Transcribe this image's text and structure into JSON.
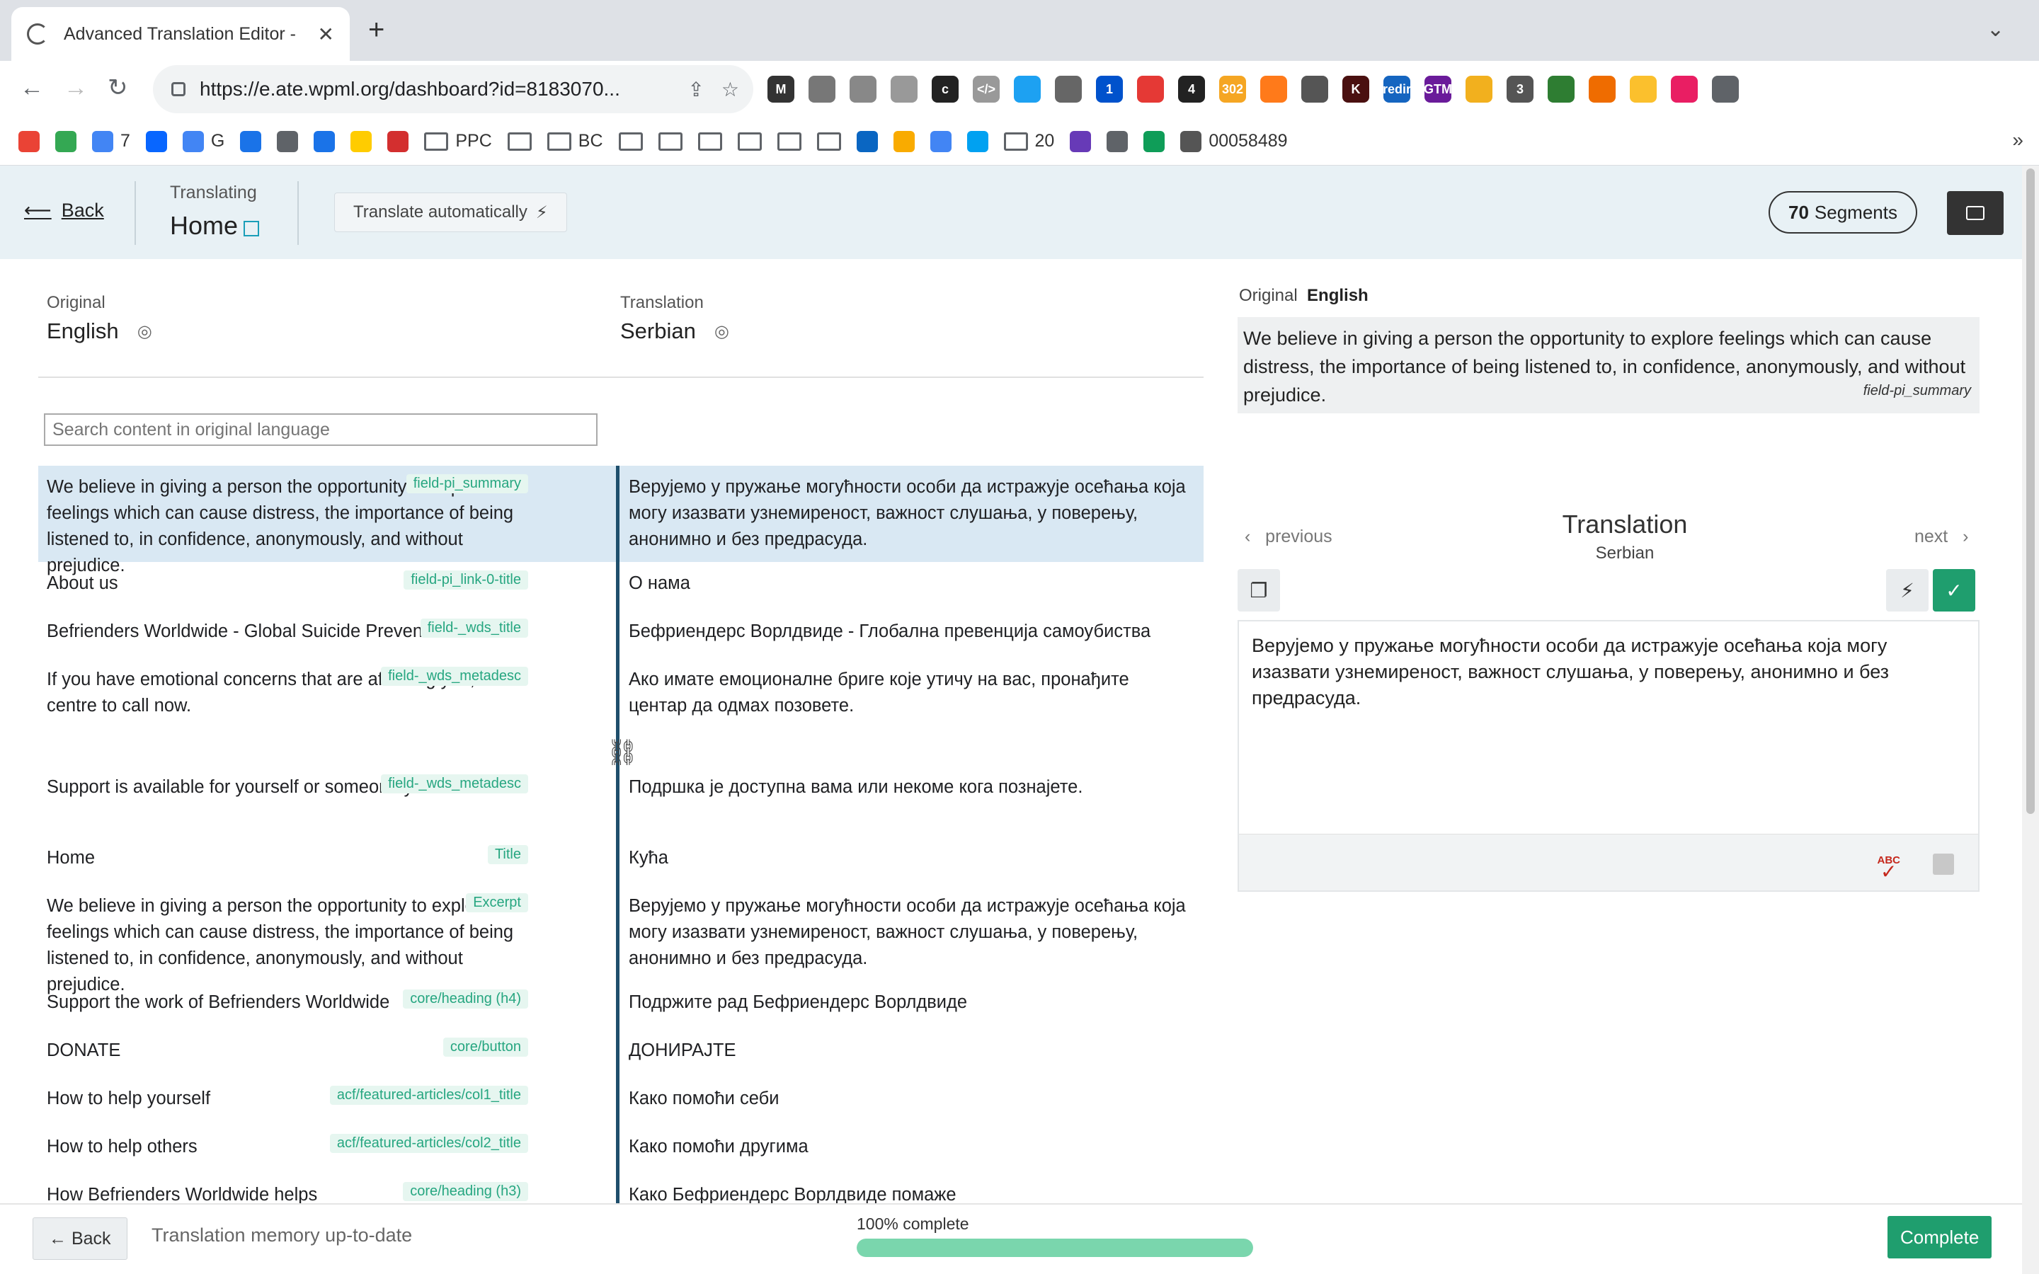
{
  "browser": {
    "tab_title": "Advanced Translation Editor -",
    "url": "https://e.ate.wpml.org/dashboard?id=8183070...",
    "extensions": [
      {
        "label": "M",
        "color": "#333333"
      },
      {
        "label": "",
        "color": "#777777"
      },
      {
        "label": "",
        "color": "#888888"
      },
      {
        "label": "",
        "color": "#999999"
      },
      {
        "label": "c",
        "color": "#222222"
      },
      {
        "label": "</>",
        "color": "#999999"
      },
      {
        "label": "",
        "color": "#1da1f2"
      },
      {
        "label": "",
        "color": "#666666"
      },
      {
        "label": "1",
        "color": "#0052cc"
      },
      {
        "label": "",
        "color": "#e53935"
      },
      {
        "label": "4",
        "color": "#222222"
      },
      {
        "label": "302",
        "color": "#f5a623"
      },
      {
        "label": "",
        "color": "#ff7a1a"
      },
      {
        "label": "",
        "color": "#555555"
      },
      {
        "label": "K",
        "color": "#4a1010"
      },
      {
        "label": "redir",
        "color": "#1565c0"
      },
      {
        "label": "GTM",
        "color": "#6a1b9a"
      },
      {
        "label": "",
        "color": "#f2b01e"
      },
      {
        "label": "3",
        "color": "#555555"
      },
      {
        "label": "",
        "color": "#2e7d32"
      },
      {
        "label": "",
        "color": "#ef6c00"
      },
      {
        "label": "",
        "color": "#fbc02d"
      },
      {
        "label": "",
        "color": "#e91e63"
      },
      {
        "label": "",
        "color": "#5f6368"
      }
    ],
    "bookmarks": [
      {
        "label": "",
        "color": "#ea4335"
      },
      {
        "label": "",
        "color": "#34a853"
      },
      {
        "label": "7",
        "color": "#4285f4"
      },
      {
        "label": "",
        "color": "#0866ff"
      },
      {
        "label": "G",
        "color": "#4285f4"
      },
      {
        "label": "",
        "color": "#1a73e8"
      },
      {
        "label": "",
        "color": "#5f6368"
      },
      {
        "label": "",
        "color": "#1a73e8"
      },
      {
        "label": "",
        "color": "#ffcc00"
      },
      {
        "label": "",
        "color": "#d32f2f"
      },
      {
        "label": "PPC",
        "color": ""
      },
      {
        "label": "",
        "color": ""
      },
      {
        "label": "BC",
        "color": ""
      },
      {
        "label": "",
        "color": ""
      },
      {
        "label": "",
        "color": ""
      },
      {
        "label": "",
        "color": ""
      },
      {
        "label": "",
        "color": ""
      },
      {
        "label": "",
        "color": ""
      },
      {
        "label": "",
        "color": ""
      },
      {
        "label": "",
        "color": "#0a66c2"
      },
      {
        "label": "",
        "color": "#f9ab00"
      },
      {
        "label": "",
        "color": "#4285f4"
      },
      {
        "label": "",
        "color": "#00a1f1"
      },
      {
        "label": "20",
        "color": ""
      },
      {
        "label": "",
        "color": "#673ab7"
      },
      {
        "label": "",
        "color": "#5f6368"
      },
      {
        "label": "",
        "color": "#0f9d58"
      },
      {
        "label": "00058489",
        "color": "#555555"
      }
    ],
    "more_bookmarks": "»"
  },
  "header": {
    "back_label": "Back",
    "translating_label": "Translating",
    "page_name": "Home",
    "auto_translate_label": "Translate automatically",
    "segments_count": "70",
    "segments_label": "Segments"
  },
  "languages": {
    "original_label": "Original",
    "original_lang": "English",
    "translation_label": "Translation",
    "translation_lang": "Serbian"
  },
  "search": {
    "placeholder": "Search content in original language"
  },
  "segments": [
    {
      "source": "We believe in giving a person the opportunity to explore feelings which can cause distress, the importance of being listened to, in confidence, anonymously, and without prejudice.",
      "tag": "field-pi_summary",
      "target": "Верујемо у пружање могућности особи да истражује осећања која могу изазвати узнемиреност, важност слушања, у поверењу, анонимно и без предрасуда."
    },
    {
      "source": "About us",
      "tag": "field-pi_link-0-title",
      "target": "О нама"
    },
    {
      "source": "Befrienders Worldwide - Global Suicide Prevention",
      "tag": "field-_wds_title",
      "target": "Бефриендерс Ворлдвиде - Глобална превенција самоубиства"
    },
    {
      "source": "If you have emotional concerns that are affecting you, find a centre to call now.",
      "tag": "field-_wds_metadesc",
      "target": "Ако имате емоционалне бриге које утичу на вас, пронађите центар да одмах позовете."
    },
    {
      "source": "Support is available for yourself or someone you know.",
      "tag": "field-_wds_metadesc",
      "target": "Подршка је доступна вама или некоме кога познајете."
    },
    {
      "source": "Home",
      "tag": "Title",
      "target": "Кућа"
    },
    {
      "source": "We believe in giving a person the opportunity to explore feelings which can cause distress, the importance of being listened to, in confidence, anonymously, and without prejudice.",
      "tag": "Excerpt",
      "target": "Верујемо у пружање могућности особи да истражује осећања која могу изазвати узнемиреност, важност слушања, у поверењу, анонимно и без предрасуда."
    },
    {
      "source": "Support the work of Befrienders Worldwide",
      "tag": "core/heading (h4)",
      "target": "Подржите рад Бефриендерс Ворлдвиде"
    },
    {
      "source": "DONATE",
      "tag": "core/button",
      "target": "ДОНИРАЈТЕ"
    },
    {
      "source": "How to help yourself",
      "tag": "acf/featured-articles/col1_title",
      "target": "Како помоћи себи"
    },
    {
      "source": "How to help others",
      "tag": "acf/featured-articles/col2_title",
      "target": "Како помоћи другима"
    },
    {
      "source": "How Befrienders Worldwide helps",
      "tag": "core/heading (h3)",
      "target": "Како Бефриендерс Ворлдвиде помаже"
    }
  ],
  "side_panel": {
    "original_label": "Original",
    "original_lang": "English",
    "original_text": "We believe in giving a person the opportunity to explore feelings which can cause distress, the importance of being listened to, in confidence, anonymously, and without prejudice.",
    "original_field": "field-pi_summary",
    "previous_label": "previous",
    "next_label": "next",
    "translation_title": "Translation",
    "translation_lang": "Serbian",
    "translation_text": "Верујемо у пружање могућности особи да истражује осећања која могу изазвати узнемиреност, важност слушања, у поверењу, анонимно и без предрасуда.",
    "spellcheck_label": "ABC"
  },
  "footer": {
    "back_label": "← Back",
    "tm_status": "Translation memory up-to-date",
    "complete_pct_label": "100% complete",
    "progress_fraction": 1.0,
    "complete_label": "Complete"
  },
  "colors": {
    "accent_green": "#1f9e6e",
    "tag_green": "#26a680",
    "active_row": "#d9e8f3",
    "header_bg": "#e8f1f5"
  }
}
